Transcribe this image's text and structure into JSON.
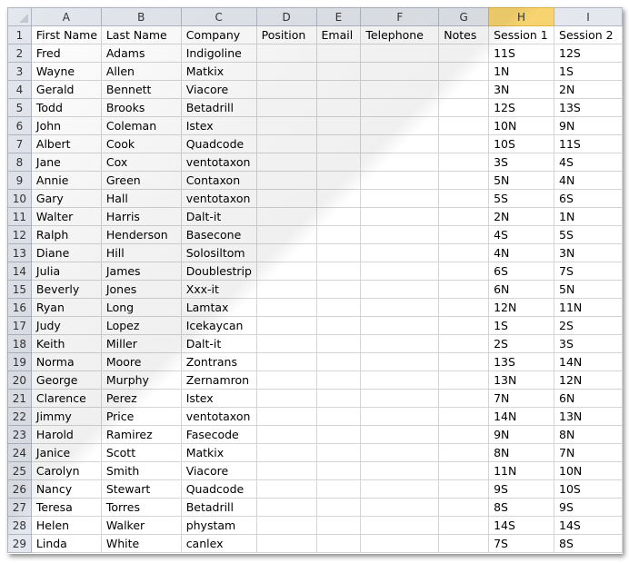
{
  "columns": [
    "A",
    "B",
    "C",
    "D",
    "E",
    "F",
    "G",
    "H",
    "I"
  ],
  "selected_column": "H",
  "colors": {
    "header_bg": "#e4e8ee",
    "selected_header_bg": "#f8d470",
    "gridline": "#d4d4d4"
  },
  "header_row": [
    "First Name",
    "Last Name",
    "Company",
    "Position",
    "Email",
    "Telephone",
    "Notes",
    "Session 1",
    "Session 2"
  ],
  "rows": [
    [
      "Fred",
      "Adams",
      "Indigoline",
      "",
      "",
      "",
      "",
      "11S",
      "12S"
    ],
    [
      "Wayne",
      "Allen",
      "Matkix",
      "",
      "",
      "",
      "",
      "1N",
      "1S"
    ],
    [
      "Gerald",
      "Bennett",
      "Viacore",
      "",
      "",
      "",
      "",
      "3N",
      "2N"
    ],
    [
      "Todd",
      "Brooks",
      "Betadrill",
      "",
      "",
      "",
      "",
      "12S",
      "13S"
    ],
    [
      "John",
      "Coleman",
      "Istex",
      "",
      "",
      "",
      "",
      "10N",
      "9N"
    ],
    [
      "Albert",
      "Cook",
      "Quadcode",
      "",
      "",
      "",
      "",
      "10S",
      "11S"
    ],
    [
      "Jane",
      "Cox",
      "ventotaxon",
      "",
      "",
      "",
      "",
      "3S",
      "4S"
    ],
    [
      "Annie",
      "Green",
      "Contaxon",
      "",
      "",
      "",
      "",
      "5N",
      "4N"
    ],
    [
      "Gary",
      "Hall",
      "ventotaxon",
      "",
      "",
      "",
      "",
      "5S",
      "6S"
    ],
    [
      "Walter",
      "Harris",
      "Dalt-it",
      "",
      "",
      "",
      "",
      "2N",
      "1N"
    ],
    [
      "Ralph",
      "Henderson",
      "Basecone",
      "",
      "",
      "",
      "",
      "4S",
      "5S"
    ],
    [
      "Diane",
      "Hill",
      "Solosiltom",
      "",
      "",
      "",
      "",
      "4N",
      "3N"
    ],
    [
      "Julia",
      "James",
      "Doublestrip",
      "",
      "",
      "",
      "",
      "6S",
      "7S"
    ],
    [
      "Beverly",
      "Jones",
      "Xxx-it",
      "",
      "",
      "",
      "",
      "6N",
      "5N"
    ],
    [
      "Ryan",
      "Long",
      "Lamtax",
      "",
      "",
      "",
      "",
      "12N",
      "11N"
    ],
    [
      "Judy",
      "Lopez",
      "Icekaycan",
      "",
      "",
      "",
      "",
      "1S",
      "2S"
    ],
    [
      "Keith",
      "Miller",
      "Dalt-it",
      "",
      "",
      "",
      "",
      "2S",
      "3S"
    ],
    [
      "Norma",
      "Moore",
      "Zontrans",
      "",
      "",
      "",
      "",
      "13S",
      "14N"
    ],
    [
      "George",
      "Murphy",
      "Zernamron",
      "",
      "",
      "",
      "",
      "13N",
      "12N"
    ],
    [
      "Clarence",
      "Perez",
      "Istex",
      "",
      "",
      "",
      "",
      "7N",
      "6N"
    ],
    [
      "Jimmy",
      "Price",
      "ventotaxon",
      "",
      "",
      "",
      "",
      "14N",
      "13N"
    ],
    [
      "Harold",
      "Ramirez",
      "Fasecode",
      "",
      "",
      "",
      "",
      "9N",
      "8N"
    ],
    [
      "Janice",
      "Scott",
      "Matkix",
      "",
      "",
      "",
      "",
      "8N",
      "7N"
    ],
    [
      "Carolyn",
      "Smith",
      "Viacore",
      "",
      "",
      "",
      "",
      "11N",
      "10N"
    ],
    [
      "Nancy",
      "Stewart",
      "Quadcode",
      "",
      "",
      "",
      "",
      "9S",
      "10S"
    ],
    [
      "Teresa",
      "Torres",
      "Betadrill",
      "",
      "",
      "",
      "",
      "8S",
      "9S"
    ],
    [
      "Helen",
      "Walker",
      "phystam",
      "",
      "",
      "",
      "",
      "14S",
      "14S"
    ],
    [
      "Linda",
      "White",
      "canlex",
      "",
      "",
      "",
      "",
      "7S",
      "8S"
    ]
  ]
}
